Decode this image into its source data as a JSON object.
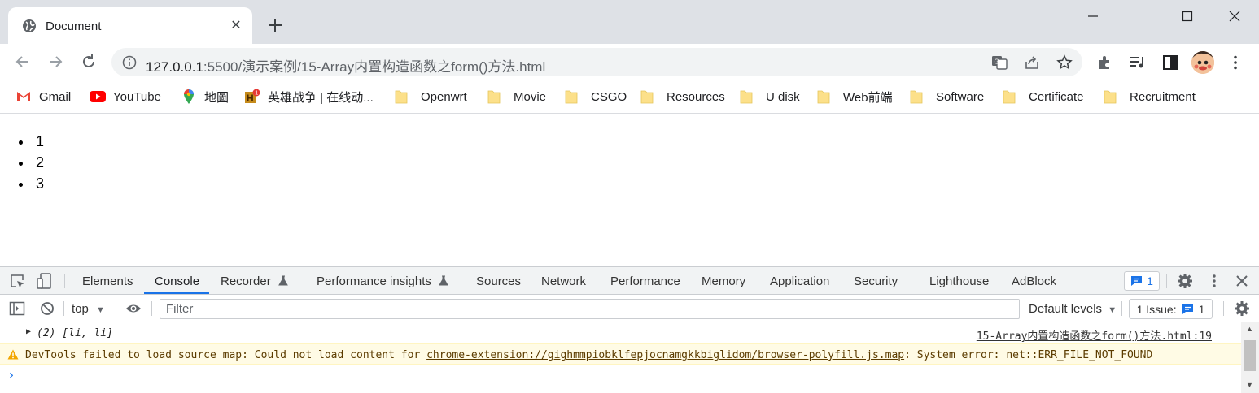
{
  "tab": {
    "title": "Document",
    "close": "✕"
  },
  "omnibox": {
    "url_host": "127.0.0.1",
    "url_rest": ":5500/演示案例/15-Array内置构造函数之form()方法.html"
  },
  "bookmarks": [
    {
      "label": "Gmail",
      "icon": "gmail-icon"
    },
    {
      "label": "YouTube",
      "icon": "youtube-icon"
    },
    {
      "label": "地圖",
      "icon": "maps-icon"
    },
    {
      "label": "英雄战争 | 在线动...",
      "icon": "game-icon"
    },
    {
      "label": "Openwrt",
      "icon": "folder-icon"
    },
    {
      "label": "Movie",
      "icon": "folder-icon"
    },
    {
      "label": "CSGO",
      "icon": "folder-icon"
    },
    {
      "label": "Resources",
      "icon": "folder-icon"
    },
    {
      "label": "U disk",
      "icon": "folder-icon"
    },
    {
      "label": "Web前端",
      "icon": "folder-icon"
    },
    {
      "label": "Software",
      "icon": "folder-icon"
    },
    {
      "label": "Certificate",
      "icon": "folder-icon"
    },
    {
      "label": "Recruitment",
      "icon": "folder-icon"
    }
  ],
  "page": {
    "list": [
      "1",
      "2",
      "3"
    ]
  },
  "devtools": {
    "tabs": [
      "Elements",
      "Console",
      "Recorder",
      "Performance insights",
      "Sources",
      "Network",
      "Performance",
      "Memory",
      "Application",
      "Security",
      "Lighthouse",
      "AdBlock"
    ],
    "active_tab": "Console",
    "issues_count": "1",
    "context": "top",
    "filter_placeholder": "Filter",
    "levels": "Default levels",
    "issue_label": "1 Issue:",
    "issue_count": "1"
  },
  "console": {
    "log": "(2) [li, li]",
    "log_source": "15-Array内置构造函数之form()方法.html:19",
    "warn_prefix": "DevTools failed to load source map: Could not load content for ",
    "warn_link": "chrome-extension://gighmmpiobklfepjocnamgkkbiglidom/browser-polyfill.js.map",
    "warn_suffix": ": System error: net::ERR_FILE_NOT_FOUND",
    "prompt": "›"
  },
  "colors": {
    "accent": "#1a73e8",
    "warn_bg": "#fffbe5",
    "tabstrip": "#dee1e6"
  }
}
